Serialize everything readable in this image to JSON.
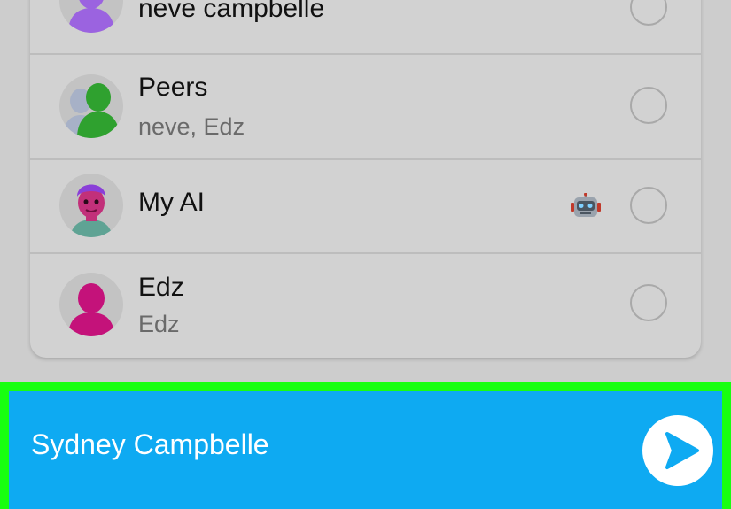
{
  "contacts": [
    {
      "name": "neve campbelle",
      "subtitle": "",
      "avatar_color": "#9b63e0",
      "avatar": "person-icon"
    },
    {
      "name": "Peers",
      "subtitle": "neve, Edz",
      "avatar_color": "#2fa12f",
      "avatar": "group-icon"
    },
    {
      "name": "My AI",
      "subtitle": "",
      "avatar": "bitmoji-icon",
      "badge": "robot-icon"
    },
    {
      "name": "Edz",
      "subtitle": "Edz",
      "avatar_color": "#c4127a",
      "avatar": "person-icon"
    }
  ],
  "send_bar": {
    "recipient": "Sydney Campbelle",
    "button_icon": "send-arrow-icon",
    "background": "#0eaaf2",
    "highlight_color": "#18ff10"
  }
}
